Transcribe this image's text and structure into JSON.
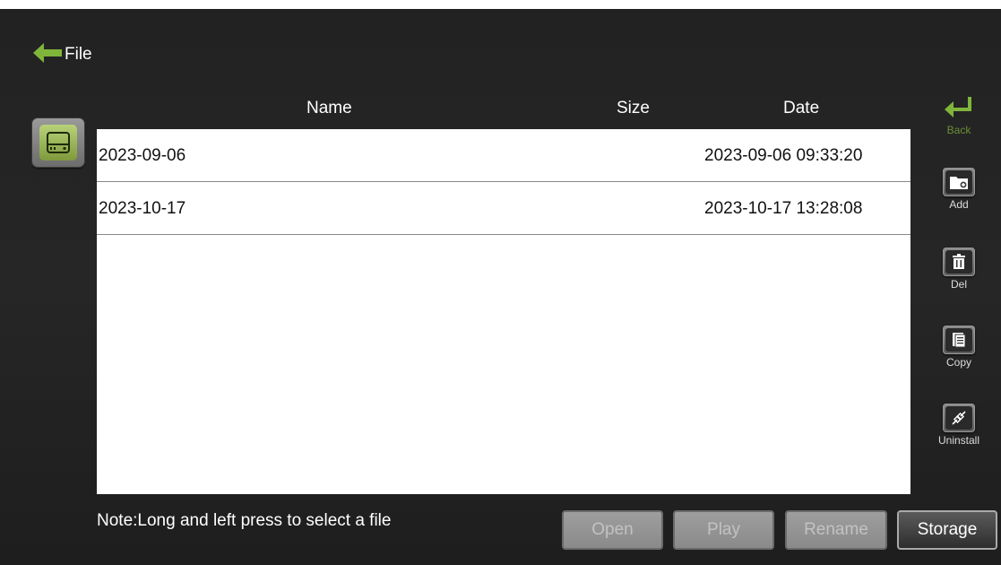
{
  "header": {
    "title": "File"
  },
  "columns": {
    "name": "Name",
    "size": "Size",
    "date": "Date"
  },
  "files": [
    {
      "name": "2023-09-06",
      "size": "",
      "date": "2023-09-06 09:33:20"
    },
    {
      "name": "2023-10-17",
      "size": "",
      "date": "2023-10-17 13:28:08"
    }
  ],
  "side_actions": {
    "back": "Back",
    "add": "Add",
    "del": "Del",
    "copy": "Copy",
    "uninstall": "Uninstall"
  },
  "note": "Note:Long and left press to select a file",
  "bottom_buttons": {
    "open": "Open",
    "play": "Play",
    "rename": "Rename",
    "storage": "Storage"
  },
  "colors": {
    "accent_green": "#7fb53a",
    "background": "#242424"
  }
}
